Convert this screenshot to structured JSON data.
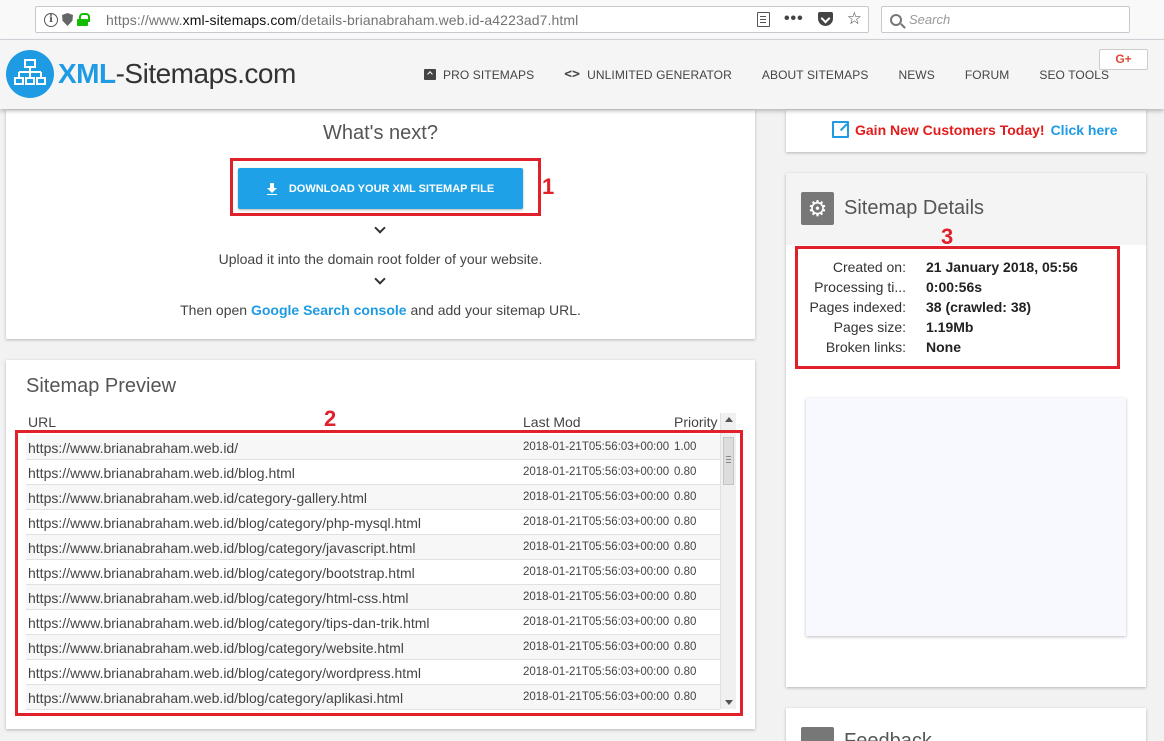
{
  "browser": {
    "url_prefix": "https://www.",
    "url_domain": "xml-sitemaps.com",
    "url_path": "/details-brianabraham.web.id-a4223ad7.html",
    "search_placeholder": "Search",
    "more_label": "•••"
  },
  "header": {
    "logo_accent": "XML",
    "logo_rest": "-Sitemaps.com",
    "nav": [
      "PRO SITEMAPS",
      "UNLIMITED GENERATOR",
      "ABOUT SITEMAPS",
      "NEWS",
      "FORUM",
      "SEO TOOLS"
    ],
    "gplus_label": "G+"
  },
  "whatsnext": {
    "title": "What's next?",
    "download_label": "DOWNLOAD YOUR XML SITEMAP FILE",
    "step1": "Upload it into the domain root folder of your website.",
    "step2_before": "Then open ",
    "step2_link": "Google Search console",
    "step2_after": " and add your sitemap URL."
  },
  "preview": {
    "title": "Sitemap Preview",
    "columns": [
      "URL",
      "Last Mod",
      "Priority"
    ],
    "rows": [
      {
        "url": "https://www.brianabraham.web.id/",
        "lastmod": "2018-01-21T05:56:03+00:00",
        "priority": "1.00"
      },
      {
        "url": "https://www.brianabraham.web.id/blog.html",
        "lastmod": "2018-01-21T05:56:03+00:00",
        "priority": "0.80"
      },
      {
        "url": "https://www.brianabraham.web.id/category-gallery.html",
        "lastmod": "2018-01-21T05:56:03+00:00",
        "priority": "0.80"
      },
      {
        "url": "https://www.brianabraham.web.id/blog/category/php-mysql.html",
        "lastmod": "2018-01-21T05:56:03+00:00",
        "priority": "0.80"
      },
      {
        "url": "https://www.brianabraham.web.id/blog/category/javascript.html",
        "lastmod": "2018-01-21T05:56:03+00:00",
        "priority": "0.80"
      },
      {
        "url": "https://www.brianabraham.web.id/blog/category/bootstrap.html",
        "lastmod": "2018-01-21T05:56:03+00:00",
        "priority": "0.80"
      },
      {
        "url": "https://www.brianabraham.web.id/blog/category/html-css.html",
        "lastmod": "2018-01-21T05:56:03+00:00",
        "priority": "0.80"
      },
      {
        "url": "https://www.brianabraham.web.id/blog/category/tips-dan-trik.html",
        "lastmod": "2018-01-21T05:56:03+00:00",
        "priority": "0.80"
      },
      {
        "url": "https://www.brianabraham.web.id/blog/category/website.html",
        "lastmod": "2018-01-21T05:56:03+00:00",
        "priority": "0.80"
      },
      {
        "url": "https://www.brianabraham.web.id/blog/category/wordpress.html",
        "lastmod": "2018-01-21T05:56:03+00:00",
        "priority": "0.80"
      },
      {
        "url": "https://www.brianabraham.web.id/blog/category/aplikasi.html",
        "lastmod": "2018-01-21T05:56:03+00:00",
        "priority": "0.80"
      }
    ]
  },
  "gain": {
    "red_text": "Gain New Customers Today!",
    "blue_text": "Click here"
  },
  "details": {
    "title": "Sitemap Details",
    "items": [
      {
        "label": "Created on:",
        "value": "21 January 2018, 05:56"
      },
      {
        "label": "Processing ti...",
        "value": "0:00:56s"
      },
      {
        "label": "Pages indexed:",
        "value": "38 (crawled: 38)"
      },
      {
        "label": "Pages size:",
        "value": "1.19Mb"
      },
      {
        "label": "Broken links:",
        "value": "None"
      }
    ]
  },
  "feedback": {
    "title": "Feedback"
  },
  "annotations": [
    "1",
    "2",
    "3"
  ],
  "colors": {
    "accent": "#1e9be3",
    "annotation": "#e0202a",
    "gain_red": "#e21b1b"
  }
}
